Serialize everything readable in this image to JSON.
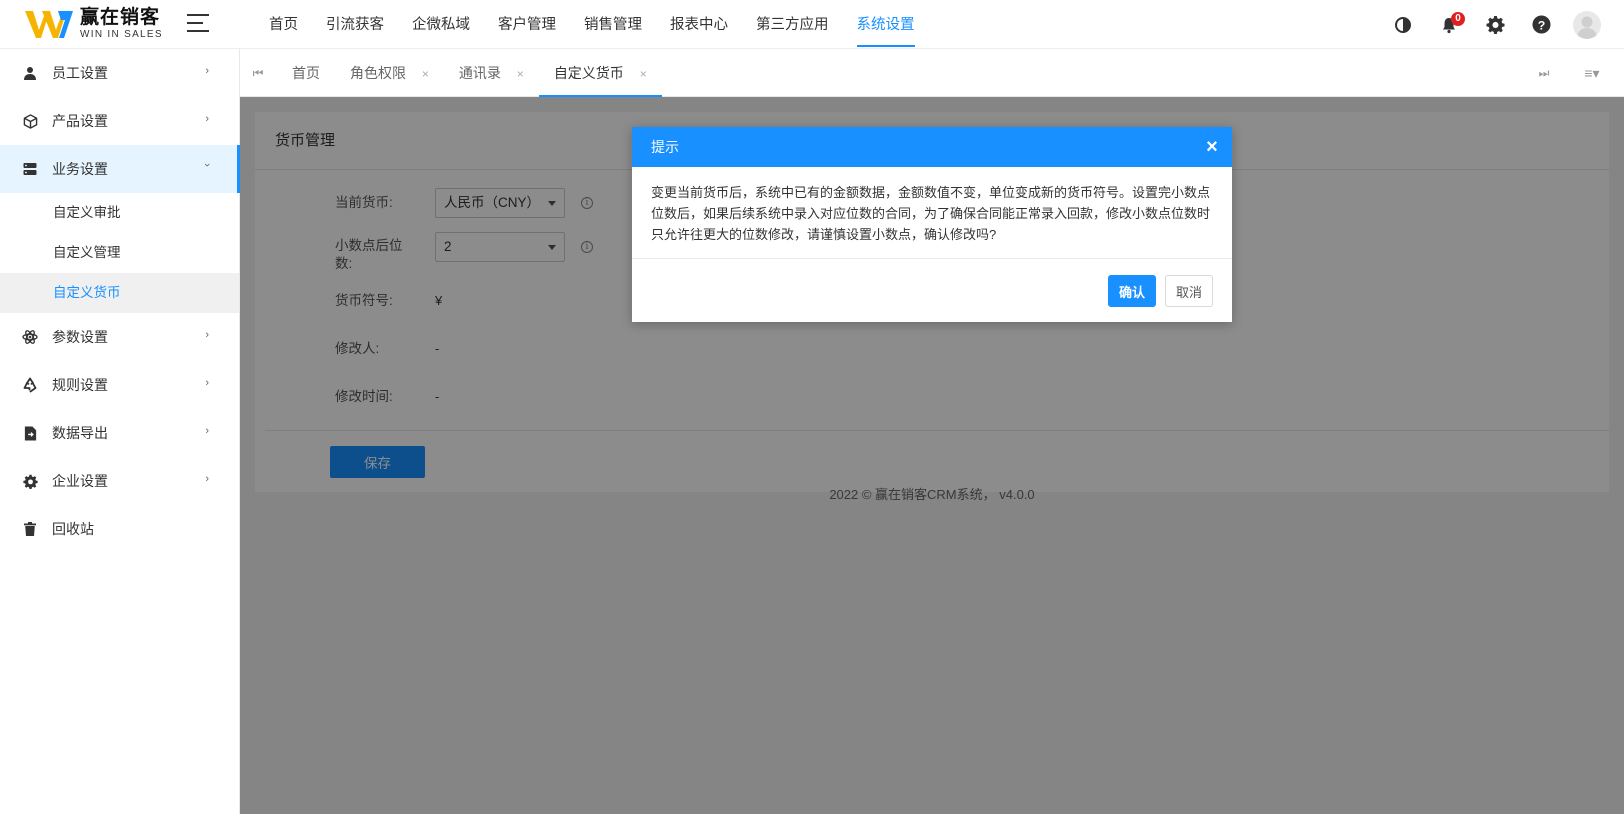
{
  "brand": {
    "name_cn": "赢在销客",
    "name_en": "WIN IN SALES",
    "colors": {
      "logo_yellow": "#f5b400",
      "logo_blue": "#1890ff",
      "accent": "#1890ff"
    }
  },
  "topnav": {
    "items": [
      {
        "label": "首页"
      },
      {
        "label": "引流获客"
      },
      {
        "label": "企微私域"
      },
      {
        "label": "客户管理"
      },
      {
        "label": "销售管理"
      },
      {
        "label": "报表中心"
      },
      {
        "label": "第三方应用"
      },
      {
        "label": "系统设置",
        "active": true
      }
    ]
  },
  "header_icons": {
    "theme": "moon-icon",
    "notifications": {
      "icon": "bell-icon",
      "count": "0"
    },
    "settings": "gear-icon",
    "help": "help-icon",
    "avatar": "user-avatar"
  },
  "sidebar": {
    "items": [
      {
        "label": "员工设置",
        "icon": "user-icon",
        "chevron": "›"
      },
      {
        "label": "产品设置",
        "icon": "cube-icon",
        "chevron": "›"
      },
      {
        "label": "业务设置",
        "icon": "server-icon",
        "chevron": "›",
        "expanded": true,
        "children": [
          {
            "label": "自定义审批"
          },
          {
            "label": "自定义管理"
          },
          {
            "label": "自定义货币",
            "active": true
          }
        ]
      },
      {
        "label": "参数设置",
        "icon": "atom-icon",
        "chevron": "›"
      },
      {
        "label": "规则设置",
        "icon": "recycle-icon",
        "chevron": "›"
      },
      {
        "label": "数据导出",
        "icon": "file-export-icon",
        "chevron": "›"
      },
      {
        "label": "企业设置",
        "icon": "gear-icon",
        "chevron": "›"
      },
      {
        "label": "回收站",
        "icon": "trash-icon"
      }
    ]
  },
  "tabs": {
    "first_icon": "⏮",
    "last_icon": "⏭",
    "menu_icon": "≡▾",
    "items": [
      {
        "label": "首页",
        "closable": false
      },
      {
        "label": "角色权限",
        "closable": true
      },
      {
        "label": "通讯录",
        "closable": true
      },
      {
        "label": "自定义货币",
        "closable": true,
        "active": true
      }
    ],
    "close_glyph": "×"
  },
  "currency_page": {
    "title": "货币管理",
    "current_currency": {
      "label": "当前货币:",
      "value": "人民币（CNY）"
    },
    "decimal_places": {
      "label": "小数点后位数:",
      "value": "2"
    },
    "symbol": {
      "label": "货币符号:",
      "value": "¥"
    },
    "modifier": {
      "label": "修改人:",
      "value": "-"
    },
    "modified_time": {
      "label": "修改时间:",
      "value": "-"
    },
    "info_glyph": "i",
    "save_label": "保存"
  },
  "footer": {
    "text": "2022 © 赢在销客CRM系统， v4.0.0"
  },
  "dialog": {
    "title": "提示",
    "close_glyph": "×",
    "message": "变更当前货币后，系统中已有的金额数据，金额数值不变，单位变成新的货币符号。设置完小数点位数后，如果后续系统中录入对应位数的合同，为了确保合同能正常录入回款，修改小数点位数时只允许往更大的位数修改，请谨慎设置小数点，确认修改吗?",
    "confirm_label": "确认",
    "cancel_label": "取消"
  }
}
